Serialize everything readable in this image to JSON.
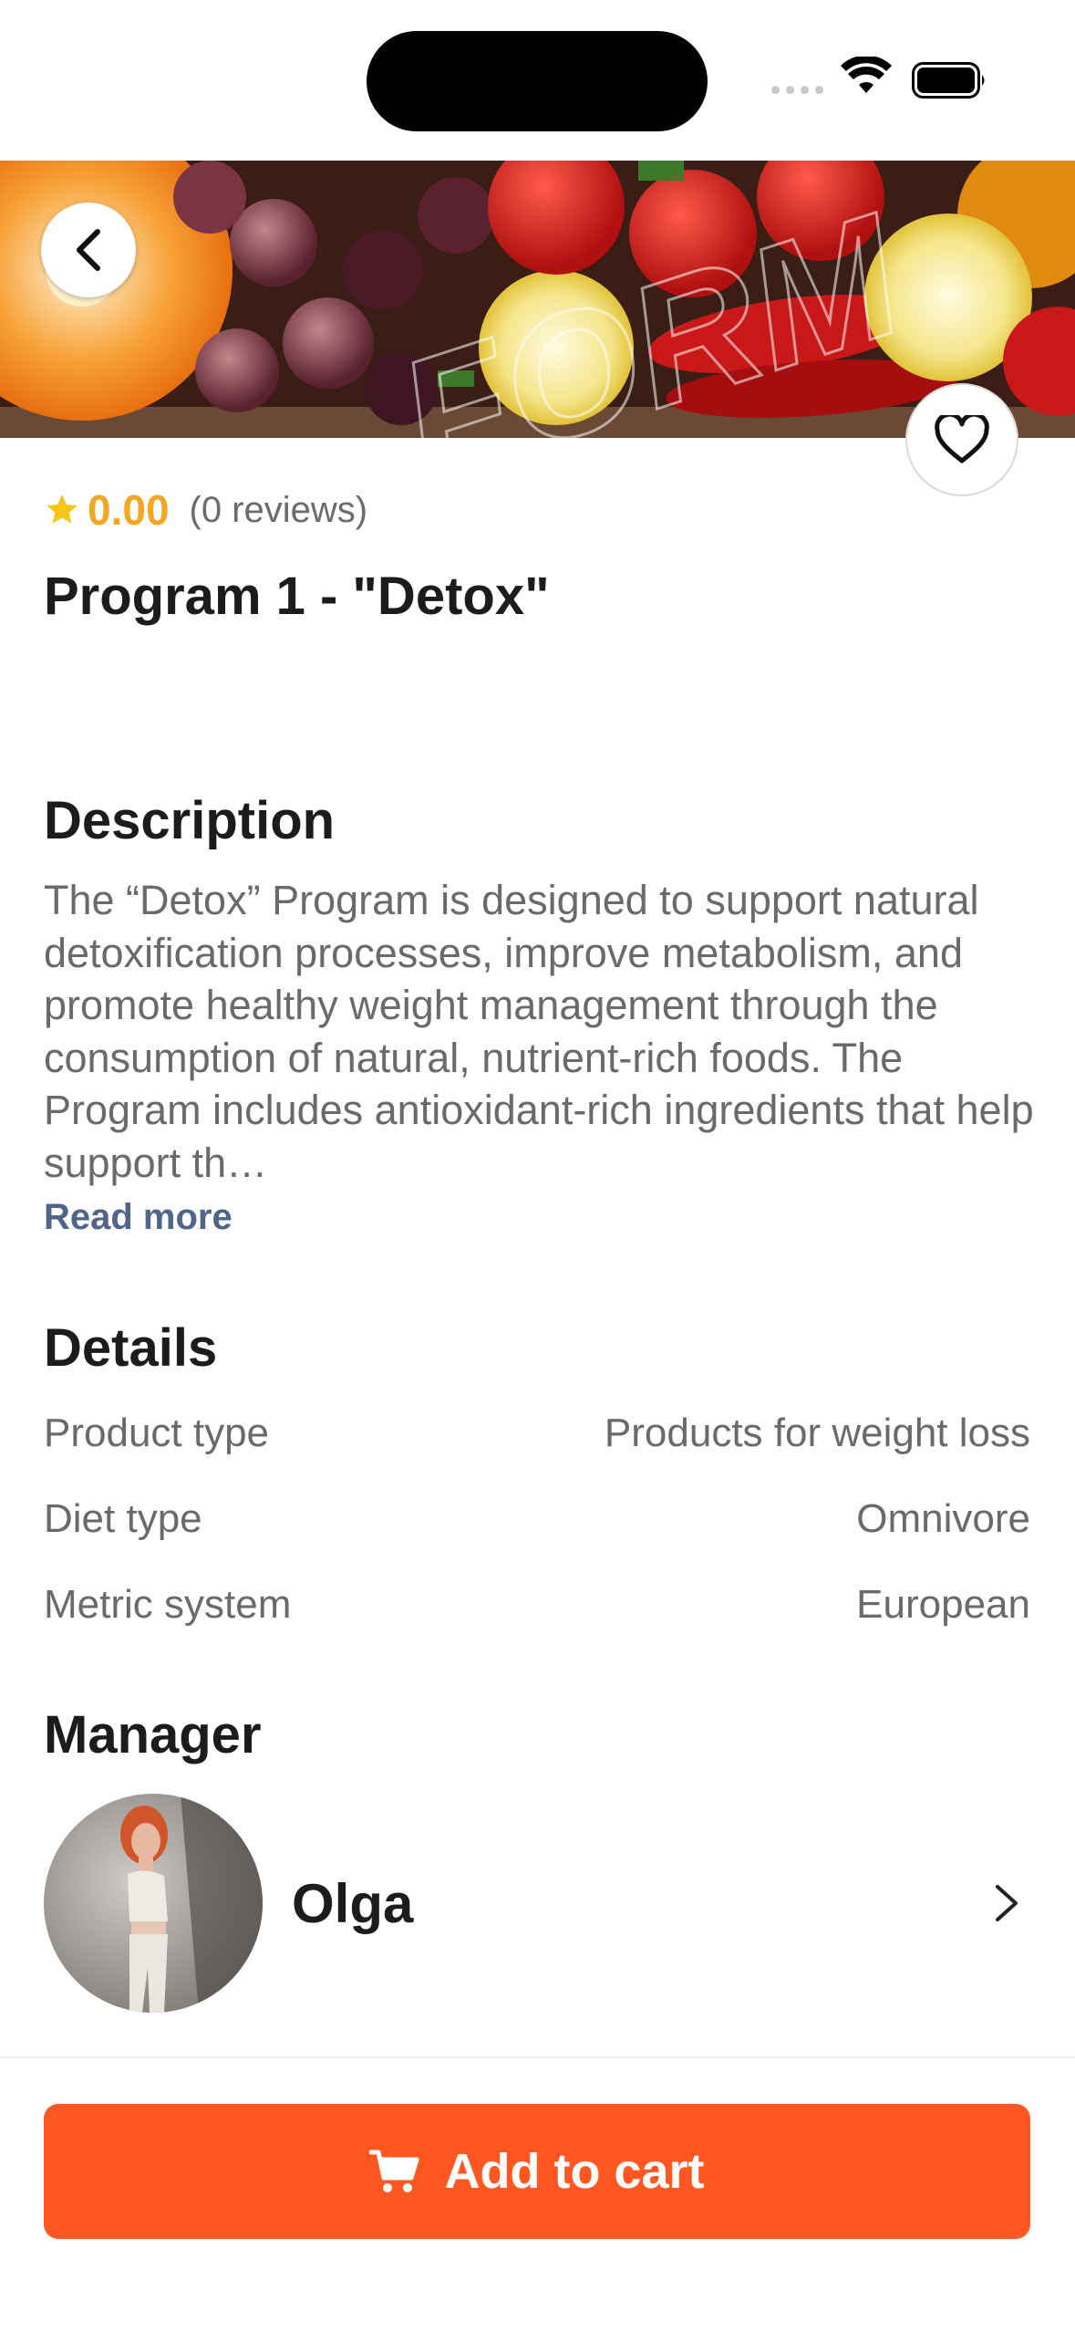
{
  "icons": {
    "back": "chevron-left-icon",
    "favorite": "heart-icon",
    "rating": "star-icon",
    "manager_open": "chevron-right-icon",
    "cart": "cart-icon",
    "status": [
      "wifi-icon",
      "battery-icon"
    ]
  },
  "colors": {
    "accent": "#ff5722",
    "rating": "#f5a623",
    "link": "#51648a",
    "muted_text": "#6a6a6a"
  },
  "hero": {
    "watermark": "FORM"
  },
  "product": {
    "rating_value": "0.00",
    "review_count": "(0 reviews)",
    "title": "Program 1 - \"Detox\""
  },
  "description": {
    "heading": "Description",
    "text": "The “Detox” Program is designed to support natural detoxification processes, improve metabolism, and promote healthy weight management through the consumption of natural, nutrient-rich foods. The Program includes antioxidant-rich ingredients that help support th…",
    "read_more": "Read more"
  },
  "details": {
    "heading": "Details",
    "rows": [
      {
        "label": "Product type",
        "value": "Products for weight loss"
      },
      {
        "label": "Diet type",
        "value": "Omnivore"
      },
      {
        "label": "Metric system",
        "value": "European"
      }
    ]
  },
  "manager": {
    "heading": "Manager",
    "name": "Olga"
  },
  "cart": {
    "label": "Add to cart"
  }
}
